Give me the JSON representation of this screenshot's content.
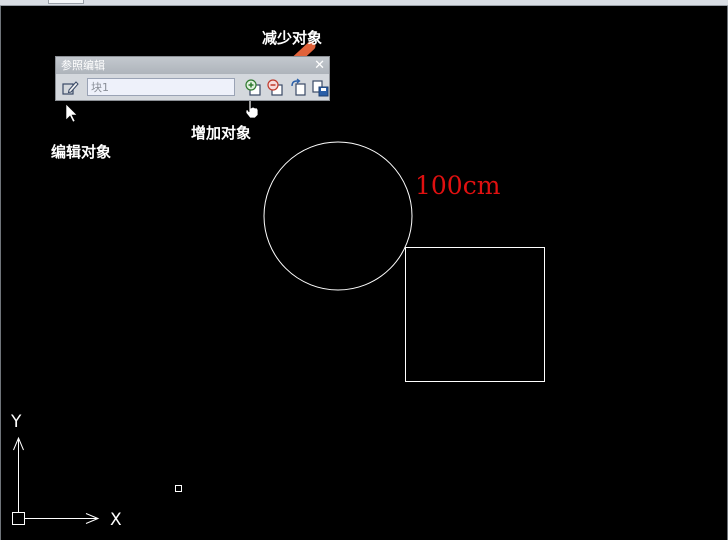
{
  "toolbar": {
    "title": "参照编辑",
    "close_glyph": "✕",
    "block_name_value": "块1",
    "buttons": [
      {
        "name": "edit-reference-icon"
      },
      {
        "name": "add-to-workset-icon"
      },
      {
        "name": "remove-from-workset-icon"
      },
      {
        "name": "discard-changes-icon"
      },
      {
        "name": "save-reference-icon"
      }
    ]
  },
  "annotations": {
    "remove_objects": "减少对象",
    "add_objects": "增加对象",
    "edit_objects": "编辑对象"
  },
  "drawing": {
    "dimension_text": "100cm",
    "axis_x_label": "X",
    "axis_y_label": "Y",
    "entity_color": "#ffffff",
    "dimension_color": "#e01010",
    "arrow_color": "#e0623a",
    "background_color": "#000000"
  }
}
